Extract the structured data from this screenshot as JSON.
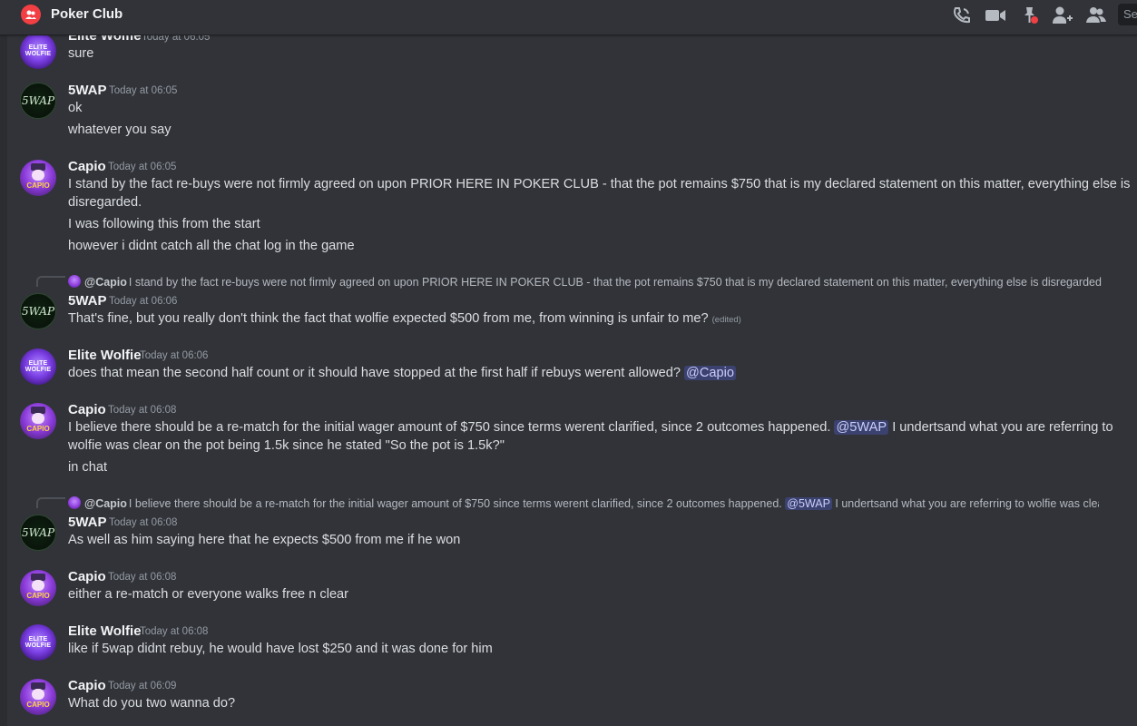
{
  "header": {
    "title": "Poker Club",
    "search_text": "Se",
    "accent": "#f23f43"
  },
  "messages": [
    {
      "author": "Elite Wolfie",
      "time": "Today at 06:05",
      "lines": [
        "sure"
      ]
    },
    {
      "author": "5WAP",
      "time": "Today at 06:05",
      "lines": [
        "ok",
        "whatever you say"
      ]
    },
    {
      "author": "Capio",
      "time": "Today at 06:05",
      "lines": [
        "I stand by the fact re-buys were not firmly agreed on upon PRIOR HERE IN POKER CLUB - that the pot remains $750 that is my declared statement on this matter, everything else is",
        "disregarded.",
        "I was following this from the start",
        "however i didnt catch all the chat log in the game"
      ]
    },
    {
      "reply": {
        "name": "@Capio",
        "text": "I stand by the fact re-buys were not firmly agreed on upon PRIOR HERE IN POKER CLUB - that the pot remains $750 that is my declared statement on this matter, everything else is disregarded."
      },
      "author": "5WAP",
      "time": "Today at 06:06",
      "lines": [
        "That's fine, but you really don't think the fact that wolfie expected $500 from me, from winning is unfair to me?"
      ],
      "edited": "(edited)"
    },
    {
      "author": "Elite Wolfie",
      "time": "Today at 06:06",
      "text": "does that mean the second half count or it should have stopped at the first half if rebuys werent allowed?",
      "mention": "@Capio"
    },
    {
      "author": "Capio",
      "time": "Today at 06:08",
      "text_a": "I believe there should be a re-match for the initial wager amount of $750 since terms werent clarified, since 2 outcomes happened.",
      "mention": "@5WAP",
      "text_b": "I undertsand what you are referring to",
      "line2": "wolfie was clear on the pot being 1.5k since he stated \"So the pot is 1.5k?\"",
      "line3": "in chat"
    },
    {
      "reply": {
        "name": "@Capio",
        "text_a": "I believe there should be a re-match for the initial wager amount of $750 since terms werent clarified, since 2 outcomes happened.",
        "mention": "@5WAP",
        "text_b": "I undertsand what you are referring to wolfie was clear o"
      },
      "author": "5WAP",
      "time": "Today at 06:08",
      "lines": [
        "As well as him saying here that he expects $500 from me if he won"
      ]
    },
    {
      "author": "Capio",
      "time": "Today at 06:08",
      "lines": [
        "either a re-match or everyone walks free n clear"
      ]
    },
    {
      "author": "Elite Wolfie",
      "time": "Today at 06:08",
      "lines": [
        "like if 5wap didnt rebuy, he would have lost $250 and it was done for him"
      ]
    },
    {
      "author": "Capio",
      "time": "Today at 06:09",
      "lines": [
        "What do you two wanna do?"
      ]
    }
  ],
  "avatars": {
    "wolfie_text": "ELITE WOLFIE",
    "swap_text": "5WAP",
    "capio_text": "CAPIO"
  }
}
